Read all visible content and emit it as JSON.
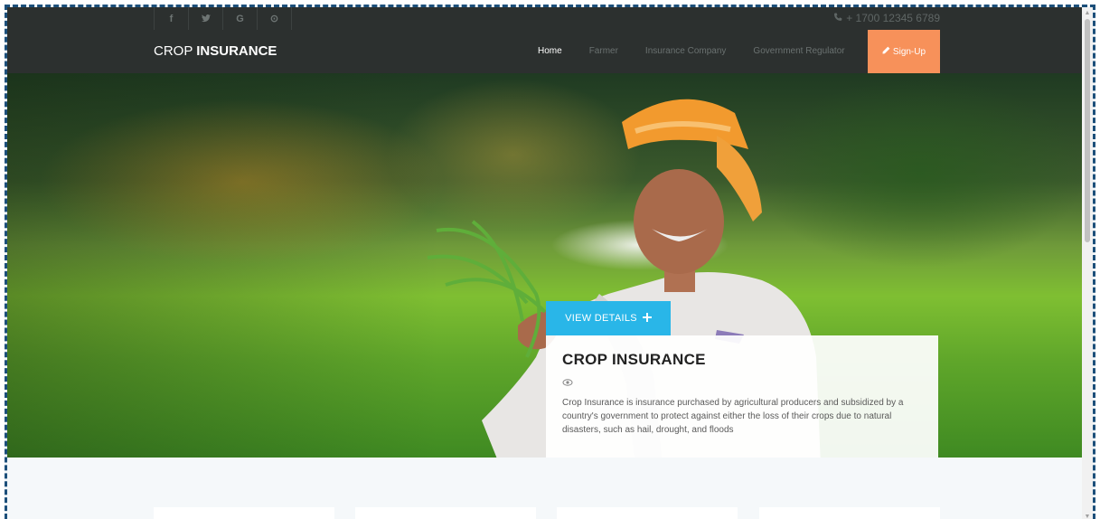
{
  "topbar": {
    "social": [
      {
        "icon": "facebook-icon",
        "glyph": "f"
      },
      {
        "icon": "twitter-icon",
        "glyph": "•"
      },
      {
        "icon": "google-icon",
        "glyph": "G"
      },
      {
        "icon": "pinterest-icon",
        "glyph": "⊙"
      }
    ],
    "phone_icon": "phone-icon",
    "phone": "+ 1700 12345 6789"
  },
  "navbar": {
    "brand_light": "CROP",
    "brand_bold": "INSURANCE",
    "menu": [
      {
        "label": "Home",
        "active": true
      },
      {
        "label": "Farmer",
        "active": false
      },
      {
        "label": "Insurance Company",
        "active": false
      },
      {
        "label": "Government Regulator",
        "active": false
      }
    ],
    "signup": {
      "icon": "pencil-icon",
      "label": "Sign-Up"
    }
  },
  "hero": {
    "button": {
      "label": "VIEW DETAILS",
      "icon": "plus-icon"
    },
    "card": {
      "title": "CROP INSURANCE",
      "eye_icon": "eye-icon",
      "text": "Crop Insurance is insurance purchased by agricultural producers and subsidized by a country's government to protect against either the loss of their crops due to natural disasters, such as hail, drought, and floods"
    }
  },
  "colors": {
    "nav_bg": "#2c302f",
    "signup": "#f7915a",
    "details": "#29b6e8",
    "frame": "#1c4f7a"
  }
}
